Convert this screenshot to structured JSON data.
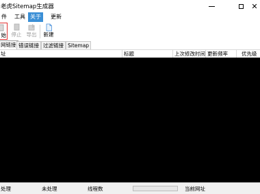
{
  "window": {
    "title": "老虎Sitemap生成器",
    "minimize_glyph": "—",
    "maximize_glyph": "☐",
    "close_glyph": "✕"
  },
  "menu": {
    "items": [
      {
        "label": "件"
      },
      {
        "label": "工具"
      },
      {
        "label": "关于",
        "active": true
      },
      {
        "label": "更新"
      }
    ]
  },
  "toolbar": {
    "start_label": "始",
    "stop_label": "停止",
    "export_label": "导出",
    "new_label": "新建"
  },
  "tabs": [
    {
      "label": "网链接",
      "active": true
    },
    {
      "label": "错误链接"
    },
    {
      "label": "过滤链接"
    },
    {
      "label": "Sitemap"
    }
  ],
  "columns": {
    "url": "址",
    "title": "标题",
    "lastmod": "上次修改时间",
    "changefreq": "更新频率",
    "priority": "优先级"
  },
  "status": {
    "processed_label": "处理",
    "unprocessed_label": "未处理",
    "threads_label": "线程数",
    "current_url_label": "当前网址"
  },
  "colors": {
    "menu_active_bg": "#3b8fd6",
    "list_bg": "#000000",
    "start_highlight": "#e03131"
  },
  "icons": [
    "start-icon",
    "stop-icon",
    "export-icon",
    "new-file-icon"
  ]
}
